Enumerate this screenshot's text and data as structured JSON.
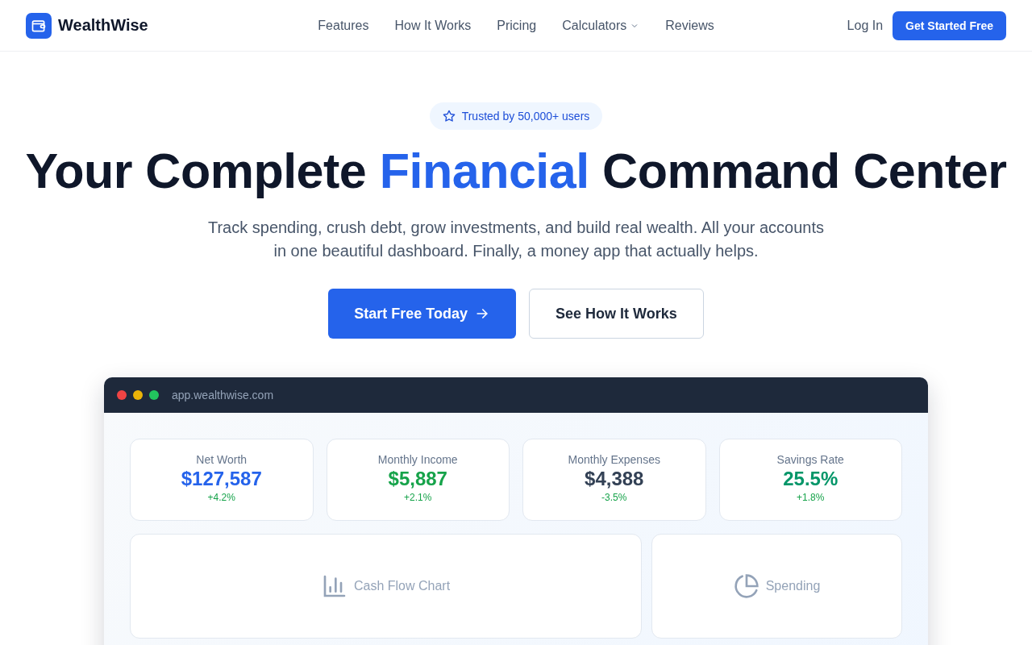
{
  "brand": {
    "name": "WealthWise"
  },
  "nav": [
    {
      "label": "Features",
      "kind": "link"
    },
    {
      "label": "How It Works",
      "kind": "link"
    },
    {
      "label": "Pricing",
      "kind": "link"
    },
    {
      "label": "Calculators",
      "kind": "dropdown"
    },
    {
      "label": "Reviews",
      "kind": "link"
    }
  ],
  "auth": {
    "login": "Log In",
    "cta": "Get Started Free"
  },
  "hero": {
    "badge": "Trusted by 50,000+ users",
    "headline_before": "Your Complete ",
    "headline_highlight": "Financial",
    "headline_after": " Command Center",
    "subtitle": "Track spending, crush debt, grow investments, and build real wealth. All your accounts in one beautiful dashboard. Finally, a money app that actually helps.",
    "primary_button": "Start Free Today",
    "secondary_button": "See How It Works"
  },
  "preview": {
    "url": "app.wealthwise.com",
    "stats": [
      {
        "label": "Net Worth",
        "value": "$127,587",
        "change": "+4.2%",
        "color": "#2563eb"
      },
      {
        "label": "Monthly Income",
        "value": "$5,887",
        "change": "+2.1%",
        "color": "#16a34a"
      },
      {
        "label": "Monthly Expenses",
        "value": "$4,388",
        "change": "-3.5%",
        "color": "#334155"
      },
      {
        "label": "Savings Rate",
        "value": "25.5%",
        "change": "+1.8%",
        "color": "#059669"
      }
    ],
    "panels": [
      {
        "label": "Cash Flow Chart",
        "kind": "bar"
      },
      {
        "label": "Spending",
        "kind": "pie"
      }
    ]
  }
}
